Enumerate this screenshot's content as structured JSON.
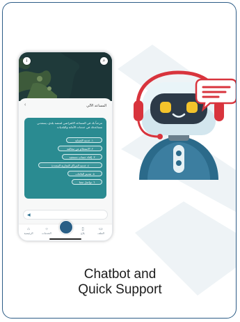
{
  "caption": {
    "line1": "Chatbot and",
    "line2": "Quick Support"
  },
  "phone": {
    "sheet_title": "المساعد الآلي",
    "bot_message": "مرحباً بك في المساعد الافتراضي لمنصة بلدي، يسعدني مساعدتك في خدمات الأمانة والبلديات",
    "options": [
      "١. خدمة الحماية",
      "٢. الاستعلام عن مخالفة",
      "٣. إلغاء حساب مستفيد",
      "٤. خدمة المراكز التجارية المحددة",
      "٥. تقديم البلاغات",
      "٦. تواصل معنا"
    ],
    "nav": {
      "home": "الرئيسية",
      "services": "الخدمات",
      "inquiry": "بلاغ",
      "profile": "الملف"
    }
  },
  "colors": {
    "border": "#2c5c86",
    "chat_panel": "#2a8b91",
    "robot_headset": "#d8343d",
    "robot_body": "#2b6a8a"
  }
}
